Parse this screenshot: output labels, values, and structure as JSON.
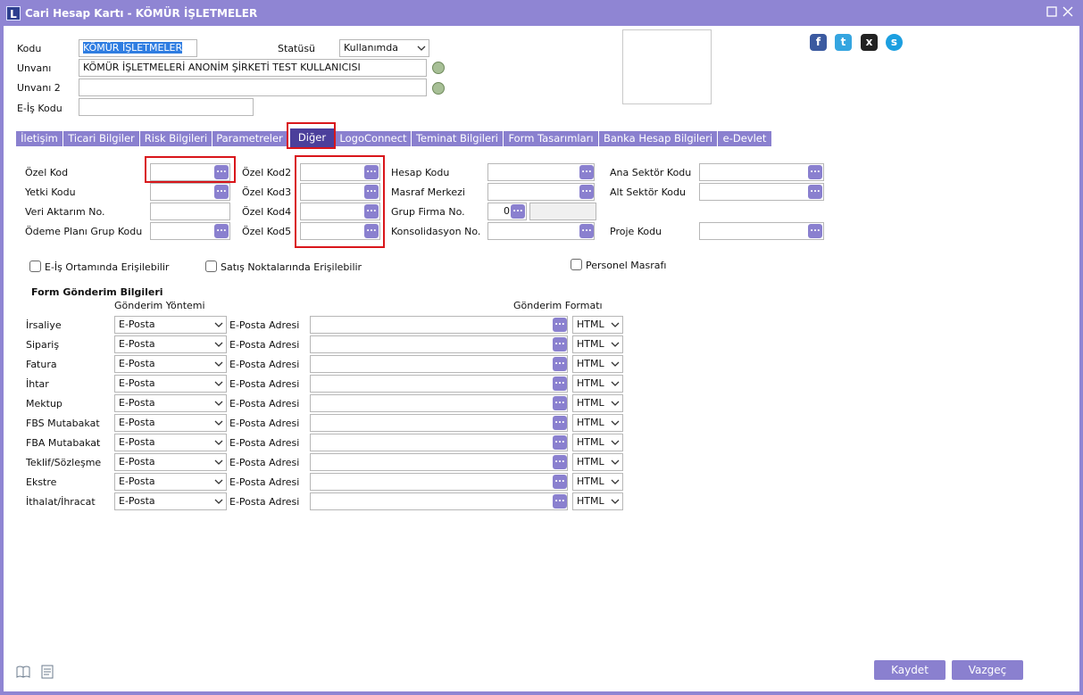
{
  "window": {
    "title": "Cari Hesap Kartı - KÖMÜR İŞLETMELER",
    "logo": "L"
  },
  "header": {
    "kodu_label": "Kodu",
    "kodu_value": "KÖMÜR İŞLETMELER",
    "statusu_label": "Statüsü",
    "statusu_value": "Kullanımda",
    "unvani_label": "Unvanı",
    "unvani_value": "KÖMÜR İŞLETMELERİ ANONİM ŞİRKETİ TEST KULLANICISI",
    "unvani2_label": "Unvanı 2",
    "unvani2_value": "",
    "eis_label": "E-İş Kodu",
    "eis_value": ""
  },
  "social": {
    "facebook": "f",
    "twitter": "t",
    "other": "x",
    "skype": "s"
  },
  "tabs": [
    {
      "label": "İletişim"
    },
    {
      "label": "Ticari Bilgiler"
    },
    {
      "label": "Risk Bilgileri"
    },
    {
      "label": "Parametreler"
    },
    {
      "label": "Diğer"
    },
    {
      "label": "LogoConnect"
    },
    {
      "label": "Teminat Bilgileri"
    },
    {
      "label": "Form Tasarımları"
    },
    {
      "label": "Banka Hesap Bilgileri"
    },
    {
      "label": "e-Devlet"
    }
  ],
  "fields": {
    "ozel_kod": "Özel Kod",
    "yetki_kodu": "Yetki Kodu",
    "veri_aktarim": "Veri Aktarım No.",
    "odeme_plani": "Ödeme Planı Grup Kodu",
    "ozel_kod2": "Özel Kod2",
    "ozel_kod3": "Özel Kod3",
    "ozel_kod4": "Özel Kod4",
    "ozel_kod5": "Özel Kod5",
    "hesap_kodu": "Hesap Kodu",
    "masraf_merkezi": "Masraf Merkezi",
    "grup_firma": "Grup Firma No.",
    "grup_firma_value": "0",
    "konsolidasyon": "Konsolidasyon No.",
    "ana_sektor": "Ana Sektör Kodu",
    "alt_sektor": "Alt Sektör Kodu",
    "proje_kodu": "Proje Kodu"
  },
  "checks": {
    "eis": "E-İş Ortamında Erişilebilir",
    "satis": "Satış Noktalarında Erişilebilir",
    "personel": "Personel Masrafı"
  },
  "form": {
    "title": "Form Gönderim Bilgileri",
    "col_method": "Gönderim Yöntemi",
    "col_format": "Gönderim Formatı",
    "email_label": "E-Posta Adresi",
    "rows": [
      {
        "name": "İrsaliye",
        "method": "E-Posta",
        "format": "HTML"
      },
      {
        "name": "Sipariş",
        "method": "E-Posta",
        "format": "HTML"
      },
      {
        "name": "Fatura",
        "method": "E-Posta",
        "format": "HTML"
      },
      {
        "name": "İhtar",
        "method": "E-Posta",
        "format": "HTML"
      },
      {
        "name": "Mektup",
        "method": "E-Posta",
        "format": "HTML"
      },
      {
        "name": "FBS Mutabakat",
        "method": "E-Posta",
        "format": "HTML"
      },
      {
        "name": "FBA Mutabakat",
        "method": "E-Posta",
        "format": "HTML"
      },
      {
        "name": "Teklif/Sözleşme",
        "method": "E-Posta",
        "format": "HTML"
      },
      {
        "name": "Ekstre",
        "method": "E-Posta",
        "format": "HTML"
      },
      {
        "name": "İthalat/İhracat",
        "method": "E-Posta",
        "format": "HTML"
      }
    ]
  },
  "buttons": {
    "save": "Kaydet",
    "cancel": "Vazgeç",
    "dots": "..."
  }
}
